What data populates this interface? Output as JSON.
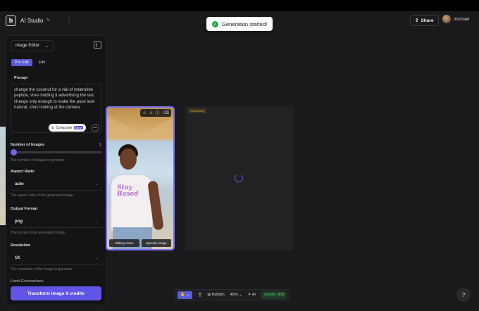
{
  "header": {
    "logo": "b",
    "title": "AI Studio",
    "share_label": "Share",
    "user_name": "michael"
  },
  "toast": {
    "message": "Generation started!"
  },
  "panel": {
    "editor_select": "Image Editor",
    "tabs": [
      {
        "label": "Pro Edit",
        "active": true
      },
      {
        "label": "Edit",
        "active": false
      }
    ],
    "prompt_label": "Prompt",
    "prompt_text": "change the coconut for a vial of retatrutide peptide, shes holding it advertising the vial, change only enough to make the pose look natural, shes looking at the camera",
    "composer_label": "Composer",
    "composer_badge": "NEW",
    "num_images_label": "Number of Images",
    "num_images_value": "1",
    "num_images_hint": "The number of images to generate.",
    "aspect_label": "Aspect Ratio",
    "aspect_value": "auto",
    "aspect_hint": "The aspect ratio of the generated image.",
    "format_label": "Output Format",
    "format_value": "png",
    "format_hint": "The format of the generated image.",
    "resolution_label": "Resolution",
    "resolution_value": "1K",
    "resolution_hint": "The resolution of the image to generate.",
    "limit_label": "Limit Generations",
    "cta_label": "Transform Image",
    "cta_credits": "9 credits"
  },
  "canvas": {
    "card_buttons": [
      "Talking Video",
      "Upscale Image"
    ],
    "status_badge": "Processing",
    "shirt_text": "Stay Based"
  },
  "toolbar": {
    "publish_label": "Publish",
    "zoom": "45%",
    "ai_label": "AI",
    "credits": "credits: 808"
  },
  "colors": {
    "accent": "#6055e6",
    "credits_green": "#5fd07a"
  }
}
